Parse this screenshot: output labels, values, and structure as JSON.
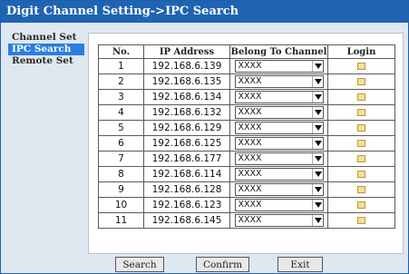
{
  "window": {
    "title": "Digit Channel Setting->IPC Search"
  },
  "sidebar": {
    "items": [
      {
        "label": "Channel Set",
        "active": false
      },
      {
        "label": "IPC Search",
        "active": true
      },
      {
        "label": "Remote Set",
        "active": false
      }
    ]
  },
  "table": {
    "headers": [
      "No.",
      "IP Address",
      "Belong To Channel",
      "Login"
    ],
    "rows": [
      {
        "no": "1",
        "ip": "192.168.6.139",
        "channel": "XXXX"
      },
      {
        "no": "2",
        "ip": "192.168.6.135",
        "channel": "XXXX"
      },
      {
        "no": "3",
        "ip": "192.168.6.134",
        "channel": "XXXX"
      },
      {
        "no": "4",
        "ip": "192.168.6.132",
        "channel": "XXXX"
      },
      {
        "no": "5",
        "ip": "192.168.6.129",
        "channel": "XXXX"
      },
      {
        "no": "6",
        "ip": "192.168.6.125",
        "channel": "XXXX"
      },
      {
        "no": "7",
        "ip": "192.168.6.177",
        "channel": "XXXX"
      },
      {
        "no": "8",
        "ip": "192.168.6.114",
        "channel": "XXXX"
      },
      {
        "no": "9",
        "ip": "192.168.6.128",
        "channel": "XXXX"
      },
      {
        "no": "10",
        "ip": "192.168.6.123",
        "channel": "XXXX"
      },
      {
        "no": "11",
        "ip": "192.168.6.145",
        "channel": "XXXX"
      }
    ]
  },
  "buttons": {
    "search": "Search",
    "confirm": "Confirm",
    "exit": "Exit"
  },
  "icons": {
    "login": "login-icon",
    "dropdown": "chevron-down-icon"
  },
  "colors": {
    "titlebar": "#1f63b3",
    "active_item": "#2a7fe0",
    "background": "#dfe8f1"
  }
}
